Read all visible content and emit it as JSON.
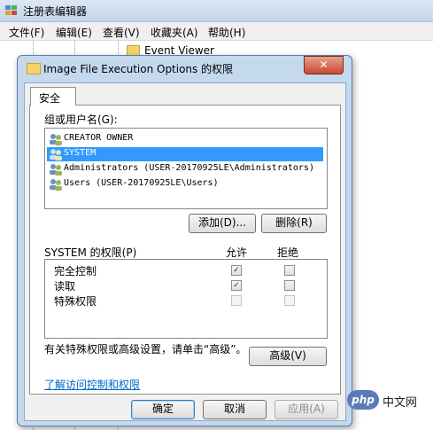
{
  "background_window": {
    "title": "注册表编辑器",
    "menu": [
      "文件(F)",
      "编辑(E)",
      "查看(V)",
      "收藏夹(A)",
      "帮助(H)"
    ],
    "tree_visible_item": "Event Viewer"
  },
  "dialog": {
    "title": "Image File Execution Options 的权限",
    "close_label": "✕",
    "tab_security": "安全",
    "group_label": "组或用户名(G):",
    "users": [
      "CREATOR OWNER",
      "SYSTEM",
      "Administrators (USER-20170925LE\\Administrators)",
      "Users (USER-20170925LE\\Users)"
    ],
    "selected_user_index": 1,
    "add_button": "添加(D)...",
    "remove_button": "删除(R)",
    "permissions_header": "SYSTEM 的权限(P)",
    "allow_header": "允许",
    "deny_header": "拒绝",
    "permissions": [
      {
        "name": "完全控制",
        "allow": true,
        "deny": false,
        "enabled": true
      },
      {
        "name": "读取",
        "allow": true,
        "deny": false,
        "enabled": true
      },
      {
        "name": "特殊权限",
        "allow": false,
        "deny": false,
        "enabled": false
      }
    ],
    "advanced_info": "有关特殊权限或高级设置，请单击“高级”。",
    "advanced_button": "高级(V)",
    "help_link": "了解访问控制和权限",
    "ok_button": "确定",
    "cancel_button": "取消",
    "apply_button": "应用(A)"
  },
  "watermark": {
    "logo_text": "php",
    "site_text": "中文网"
  }
}
